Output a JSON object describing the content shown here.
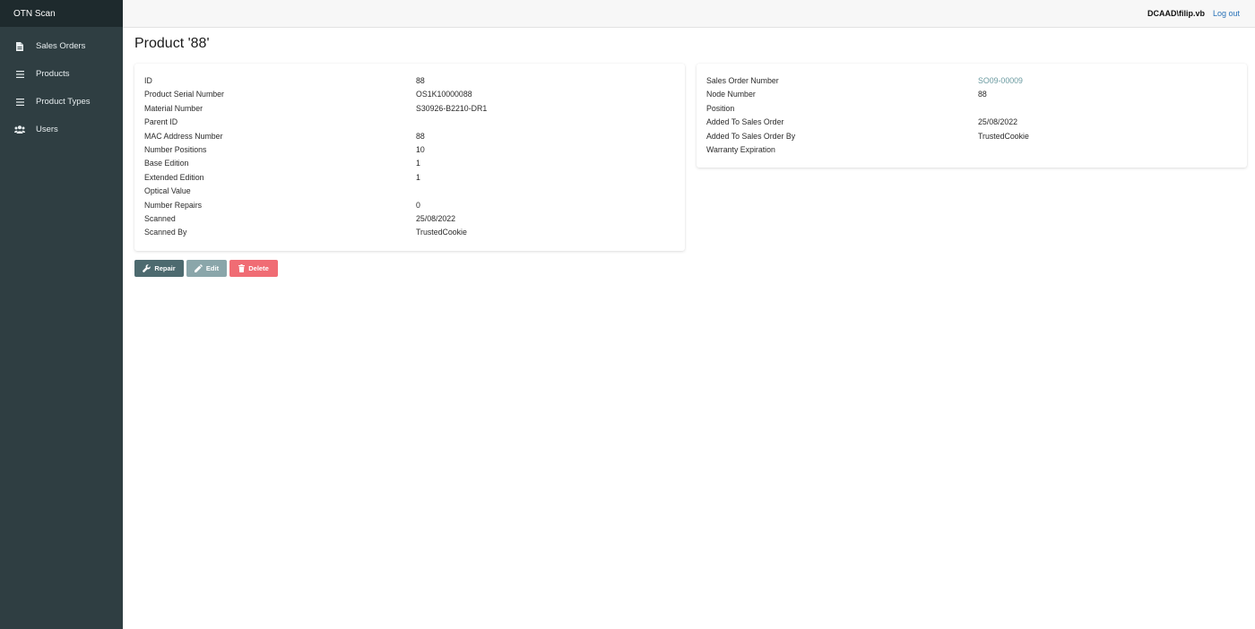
{
  "app": {
    "brand": "OTN Scan"
  },
  "sidebar": {
    "items": [
      {
        "label": "Sales Orders",
        "icon": "document-icon"
      },
      {
        "label": "Products",
        "icon": "list-icon"
      },
      {
        "label": "Product Types",
        "icon": "list-icon"
      },
      {
        "label": "Users",
        "icon": "users-icon"
      }
    ]
  },
  "topbar": {
    "user": "DCAAD\\filip.vb",
    "logout_label": "Log out"
  },
  "page": {
    "title": "Product '88'"
  },
  "product": {
    "fields": [
      {
        "label": "ID",
        "value": "88"
      },
      {
        "label": "Product Serial Number",
        "value": "OS1K10000088"
      },
      {
        "label": "Material Number",
        "value": "S30926-B2210-DR1"
      },
      {
        "label": "Parent ID",
        "value": ""
      },
      {
        "label": "MAC Address Number",
        "value": "88"
      },
      {
        "label": "Number Positions",
        "value": "10"
      },
      {
        "label": "Base Edition",
        "value": "1"
      },
      {
        "label": "Extended Edition",
        "value": "1"
      },
      {
        "label": "Optical Value",
        "value": ""
      },
      {
        "label": "Number Repairs",
        "value": "0"
      },
      {
        "label": "Scanned",
        "value": "25/08/2022"
      },
      {
        "label": "Scanned By",
        "value": "TrustedCookie"
      }
    ]
  },
  "sales_order": {
    "fields": [
      {
        "label": "Sales Order Number",
        "value": "SO09-00009"
      },
      {
        "label": "Node Number",
        "value": "88"
      },
      {
        "label": "Position",
        "value": ""
      },
      {
        "label": "Added To Sales Order",
        "value": "25/08/2022"
      },
      {
        "label": "Added To Sales Order By",
        "value": "TrustedCookie"
      },
      {
        "label": "Warranty Expiration",
        "value": ""
      }
    ]
  },
  "actions": {
    "repair_label": "Repair",
    "edit_label": "Edit",
    "delete_label": "Delete"
  },
  "colors": {
    "sidebar_bg": "#2f3e42",
    "brand_bg": "#1e2a2d",
    "link": "#2a73b8",
    "sales_order_link": "#6a9aa0",
    "repair_btn": "#4d6a6f",
    "edit_btn": "#8aa6aa",
    "delete_btn": "#f06c74"
  }
}
